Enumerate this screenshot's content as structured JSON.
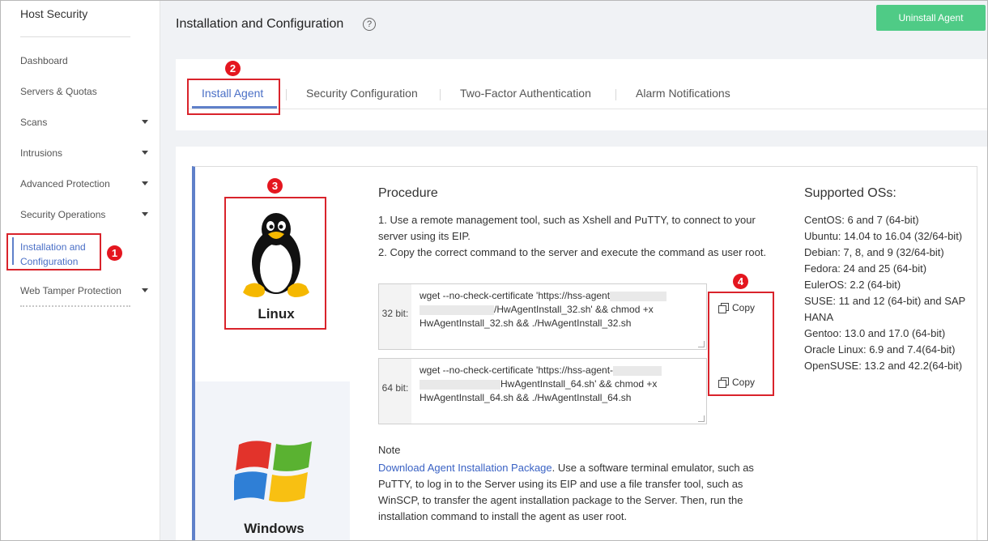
{
  "sidebar": {
    "title": "Host Security",
    "items": [
      {
        "label": "Dashboard"
      },
      {
        "label": "Servers & Quotas"
      },
      {
        "label": "Scans"
      },
      {
        "label": "Intrusions"
      },
      {
        "label": "Advanced Protection"
      },
      {
        "label": "Security Operations"
      },
      {
        "label": "Installation and Configuration"
      },
      {
        "label": "Web Tamper Protection"
      }
    ]
  },
  "header": {
    "title": "Installation and Configuration",
    "help": "?",
    "uninstall_label": "Uninstall Agent"
  },
  "tabs": [
    {
      "label": "Install Agent"
    },
    {
      "label": "Security Configuration"
    },
    {
      "label": "Two-Factor Authentication"
    },
    {
      "label": "Alarm Notifications"
    }
  ],
  "os_options": [
    {
      "label": "Linux"
    },
    {
      "label": "Windows"
    }
  ],
  "procedure": {
    "title": "Procedure",
    "step1": "1. Use a remote management tool, such as Xshell and PuTTY, to connect to your server using its EIP.",
    "step2": "2. Copy the correct command to the server and execute the command as user root.",
    "cmd32": {
      "bit": "32 bit:",
      "line1": "wget --no-check-certificate 'https://hss-agent",
      "line2": "/HwAgentInstall_32.sh' && chmod +x",
      "line3": "HwAgentInstall_32.sh && ./HwAgentInstall_32.sh"
    },
    "cmd64": {
      "bit": "64 bit:",
      "line1": "wget --no-check-certificate 'https://hss-agent-",
      "line2": "HwAgentInstall_64.sh' && chmod +x",
      "line3": "HwAgentInstall_64.sh && ./HwAgentInstall_64.sh"
    },
    "copy_label": "Copy"
  },
  "note": {
    "title": "Note",
    "link": "Download Agent Installation Package",
    "text": ". Use a software terminal emulator, such as PuTTY, to log in to the Server using its EIP and use a file transfer tool, such as WinSCP, to transfer the agent installation package to the Server. Then, run the installation command to install the agent as user root."
  },
  "supported": {
    "title": "Supported OSs:",
    "items": [
      "CentOS: 6 and 7 (64-bit)",
      "Ubuntu: 14.04 to 16.04 (32/64-bit)",
      "Debian: 7, 8, and 9 (32/64-bit)",
      "Fedora: 24 and 25 (64-bit)",
      "EulerOS: 2.2 (64-bit)",
      "SUSE: 11 and 12 (64-bit) and SAP HANA",
      "Gentoo: 13.0 and 17.0 (64-bit)",
      "Oracle Linux: 6.9 and 7.4(64-bit)",
      "OpenSUSE: 13.2 and 42.2(64-bit)"
    ]
  },
  "annotations": [
    "1",
    "2",
    "3",
    "4"
  ],
  "colors": {
    "accent": "#5f80c9",
    "primary_button": "#4fcb86",
    "annotation_red": "#d9232b",
    "link": "#3a62c4"
  }
}
